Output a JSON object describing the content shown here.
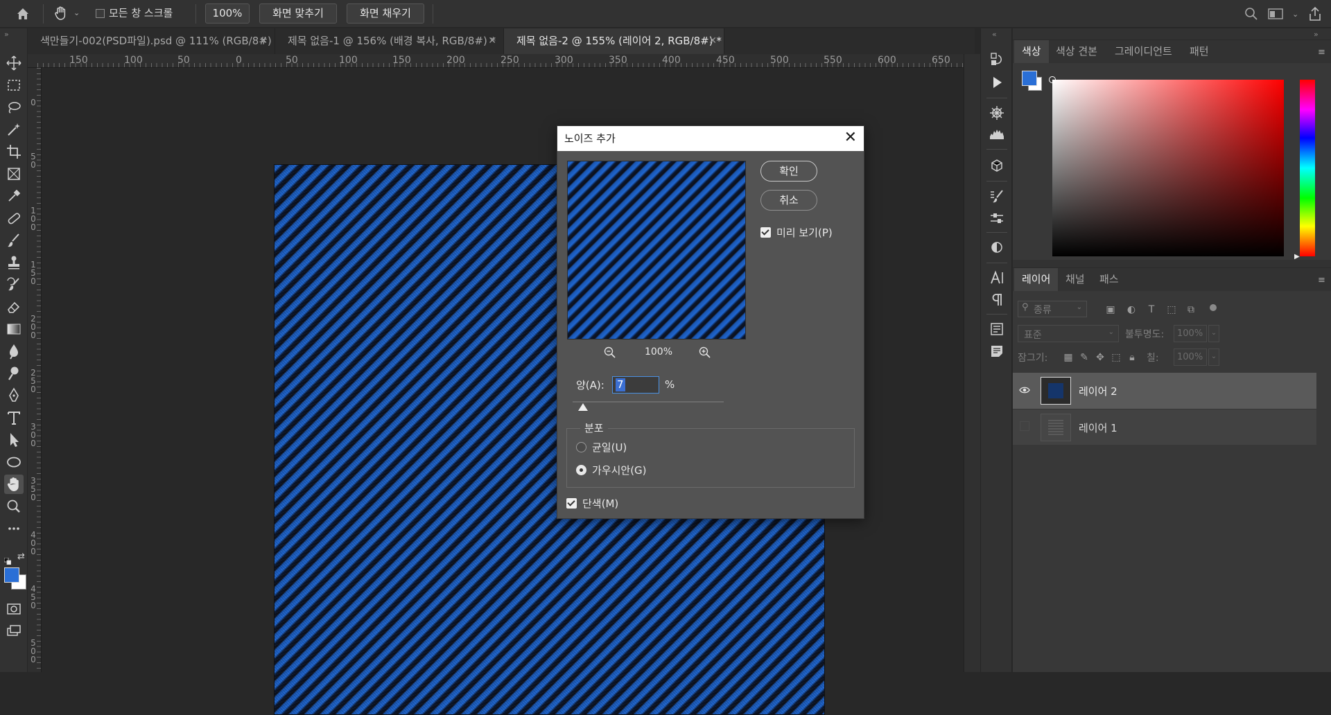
{
  "options_bar": {
    "scroll_all_label": "모든 창 스크롤",
    "zoom_btn": "100%",
    "fit_screen_btn": "화면 맞추기",
    "fill_screen_btn": "화면 채우기"
  },
  "tabs": [
    {
      "label": "색만들기-002(PSD파일).psd @ 111% (RGB/8#)",
      "active": false
    },
    {
      "label": "제목 없음-1 @ 156% (배경 복사, RGB/8#) *",
      "active": false
    },
    {
      "label": "제목 없음-2 @ 155% (레이어 2, RGB/8#) *",
      "active": true
    }
  ],
  "ruler": {
    "h_labels": [
      "150",
      "100",
      "50",
      "0",
      "50",
      "100",
      "150",
      "200",
      "250",
      "300",
      "350",
      "400",
      "450",
      "500",
      "550",
      "600",
      "650"
    ],
    "v_labels": [
      "0",
      "50",
      "100",
      "150",
      "200",
      "250",
      "300",
      "350",
      "400",
      "450",
      "500"
    ]
  },
  "dialog": {
    "title": "노이즈 추가",
    "ok": "확인",
    "cancel": "취소",
    "preview_label": "미리 보기(P)",
    "zoom_value": "100%",
    "amount_label": "양(A):",
    "amount_value": "7",
    "amount_unit": "%",
    "amount_fraction": 0.07,
    "distribution_title": "분포",
    "uniform_label": "균일(U)",
    "gaussian_label": "가우시안(G)",
    "monochrome_label": "단색(M)",
    "preview_checked": true,
    "monochrome_checked": true,
    "selected_distribution": "gaussian"
  },
  "color_panel": {
    "tabs": [
      "색상",
      "색상 견본",
      "그레이디언트",
      "패턴"
    ],
    "foreground": "#2a6fd6",
    "background": "#ffffff"
  },
  "layers_panel": {
    "tabs": [
      "레이어",
      "채널",
      "패스"
    ],
    "filter_placeholder": "종류",
    "blend_mode": "표준",
    "opacity_label": "불투명도:",
    "opacity_value": "100%",
    "lock_label": "잠그기:",
    "fill_label": "칠:",
    "fill_value": "100%",
    "layers": [
      {
        "name": "레이어 2",
        "visible": true,
        "selected": true,
        "thumb": "#15356a"
      },
      {
        "name": "레이어 1",
        "visible": false,
        "selected": false,
        "thumb": "#4a4a4a"
      }
    ]
  },
  "colors": {
    "accent": "#2a6fd6",
    "denim_light": "#1f66d0",
    "denim_dark": "#0d0f18"
  }
}
